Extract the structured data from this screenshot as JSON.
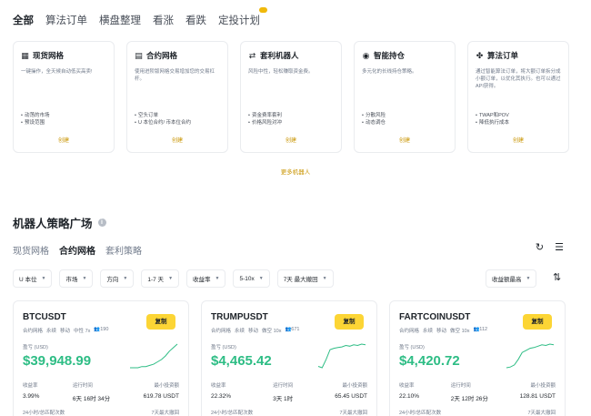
{
  "topnav": {
    "tabs": [
      "全部",
      "算法订单",
      "横盘整理",
      "看涨",
      "看跌",
      "定投计划"
    ]
  },
  "bots": [
    {
      "icon": "grid-icon",
      "glyph": "▦",
      "title": "现货网格",
      "desc": "一键操作，全天候自动低买高卖!",
      "points": [
        "动荡的市场",
        "预设范围"
      ],
      "cta": "创建"
    },
    {
      "icon": "contract-icon",
      "glyph": "▤",
      "title": "合约网格",
      "desc": "使用进阶版网格交易增加您的交易杠杆。",
      "points": [
        "空头订单",
        "U 本位合约/ 币本位合约"
      ],
      "cta": "创建"
    },
    {
      "icon": "arbitrage-icon",
      "glyph": "⇄",
      "title": "套利机器人",
      "desc": "风险中性，轻松赚取资金费。",
      "points": [
        "资金费率套利",
        "价格风险对冲"
      ],
      "cta": "创建"
    },
    {
      "icon": "rebalance-icon",
      "glyph": "◉",
      "title": "智能持仓",
      "desc": "多元化的长线持仓策略。",
      "points": [
        "分散风险",
        "动态调仓"
      ],
      "cta": "创建"
    },
    {
      "icon": "algo-icon",
      "glyph": "✤",
      "title": "算法订单",
      "desc": "通过智能算法订单，将大额订单拆分成小额订单，以优化其执行。也可以通过API获得。",
      "points": [
        "TWAP和POV",
        "降低执行成本"
      ],
      "cta": "创建"
    }
  ],
  "more_bots": "更多机器人",
  "section": {
    "title": "机器人策略广场",
    "subtabs": [
      "现货网格",
      "合约网格",
      "套利策略"
    ]
  },
  "filters": [
    "U 本位",
    "市场",
    "方向",
    "1-7 天",
    "收益率",
    "5-10x",
    "7天 最大撤回"
  ],
  "sort_filter": "收益额最高",
  "strategies": [
    {
      "symbol": "BTCUSDT",
      "tags": [
        "合约网格",
        "永续",
        "移动",
        "中性 7x",
        "👥190"
      ],
      "copy": "复制",
      "pnl_label": "盈亏 (USD)",
      "pnl": "$39,948.99",
      "labels": [
        "收益率",
        "运行时间",
        "最小投资额"
      ],
      "values": [
        "3.99%",
        "6天 16时 34分",
        "619.78 USDT"
      ],
      "footer": [
        "24小时/总匹配次数",
        "7天最大撤回"
      ],
      "spark": [
        30,
        30,
        30,
        31,
        31,
        32,
        33,
        35,
        37,
        40,
        44,
        47,
        50
      ]
    },
    {
      "symbol": "TRUMPUSDT",
      "tags": [
        "合约网格",
        "永续",
        "移动",
        "做空 10x",
        "👥671"
      ],
      "copy": "复制",
      "pnl_label": "盈亏 (USD)",
      "pnl": "$4,465.42",
      "labels": [
        "收益率",
        "运行时间",
        "最小投资额"
      ],
      "values": [
        "22.32%",
        "3天 1时",
        "65.45 USDT"
      ],
      "footer": [
        "24小时/总匹配次数",
        "7天最大撤回"
      ],
      "spark": [
        10,
        8,
        20,
        34,
        36,
        37,
        38,
        40,
        39,
        41,
        40,
        42,
        41
      ]
    },
    {
      "symbol": "FARTCOINUSDT",
      "tags": [
        "合约网格",
        "永续",
        "移动",
        "做空 10x",
        "👥112"
      ],
      "copy": "复制",
      "pnl_label": "盈亏 (USD)",
      "pnl": "$4,420.72",
      "labels": [
        "收益率",
        "运行时间",
        "最小投资额"
      ],
      "values": [
        "22.10%",
        "2天 12时 26分",
        "128.81 USDT"
      ],
      "footer": [
        "24小时/总匹配次数",
        "7天最大撤回"
      ],
      "spark": [
        8,
        9,
        12,
        20,
        30,
        33,
        36,
        37,
        39,
        41,
        40,
        42,
        41
      ]
    }
  ],
  "colors": {
    "accent": "#fcd535",
    "link": "#c99400",
    "profit": "#2ebd85"
  }
}
